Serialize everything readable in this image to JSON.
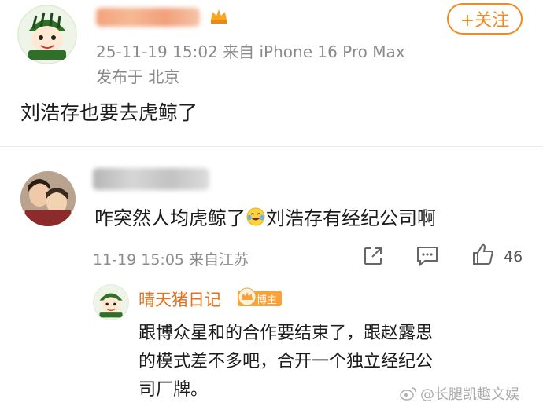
{
  "post": {
    "follow_label": "+关注",
    "meta_line1": "25-11-19 15:02  来自 iPhone 16 Pro Max",
    "meta_line2": "发布于 北京",
    "text": "刘浩存也要去虎鲸了"
  },
  "comment": {
    "text_before_emoji": "咋突然人均虎鲸了",
    "emoji_name": "laughing-crying-emoji",
    "text_after_emoji": "刘浩存有经纪公司啊",
    "meta": "11-19 15:05  来自江苏",
    "like_count": "46"
  },
  "reply": {
    "author": "晴天猪日记",
    "badge": "博主",
    "lines": [
      "跟博众星和的合作要结束了，跟赵露思",
      "的模式差不多吧，合开一个独立经纪公",
      "司厂牌。"
    ]
  },
  "colors": {
    "accent": "#f08a24",
    "reply_name": "#e3721d",
    "meta_gray": "#8a8a8a"
  },
  "watermark": {
    "text": "@长腿凯趣文娱"
  }
}
